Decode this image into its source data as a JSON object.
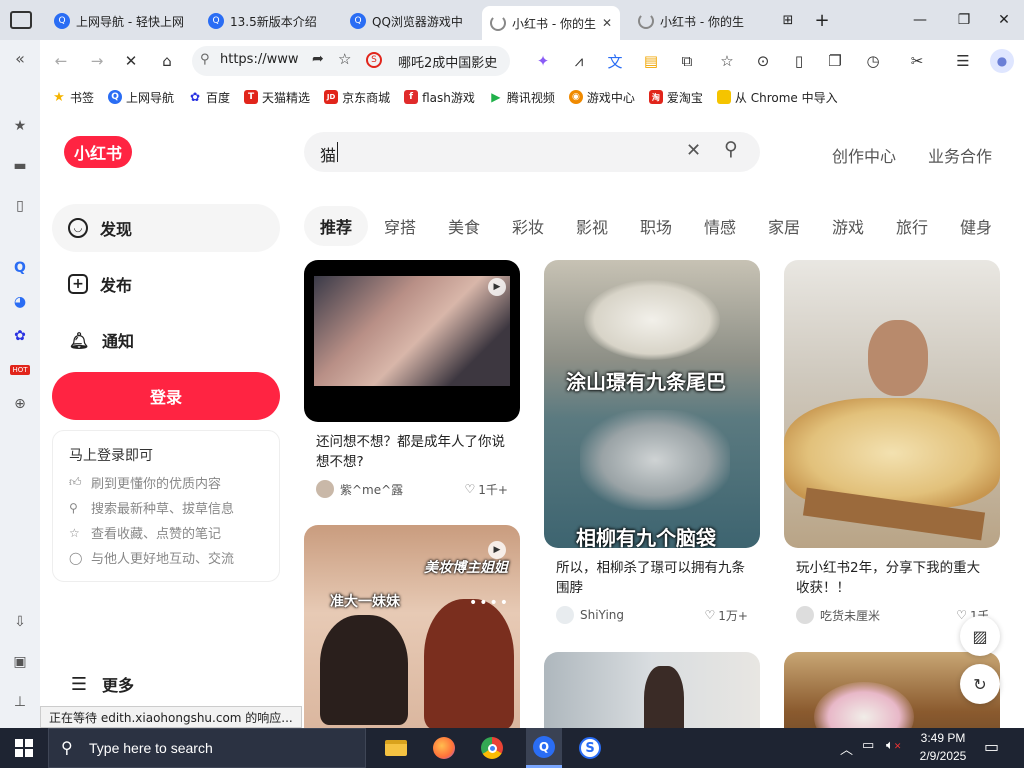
{
  "tabs": [
    {
      "label": "上网导航 - 轻快上网",
      "icon": "qq-browser-icon",
      "active": false
    },
    {
      "label": "13.5新版本介绍",
      "icon": "qq-browser-icon",
      "active": false
    },
    {
      "label": "QQ浏览器游戏中",
      "icon": "qq-browser-icon",
      "active": false
    },
    {
      "label": "小红书 - 你的生",
      "icon": "loading-spinner-icon",
      "active": true
    },
    {
      "label": "小红书 - 你的生",
      "icon": "loading-spinner-icon",
      "active": false
    }
  ],
  "toolbar": {
    "url": "https://www",
    "search_hint": "哪吒2成中国影史"
  },
  "bookmarks": [
    {
      "label": "书签",
      "color": "#f5b400",
      "glyph": "★"
    },
    {
      "label": "上网导航",
      "color": "#2a6df4",
      "glyph": "Q"
    },
    {
      "label": "百度",
      "color": "#2932e1",
      "glyph": "✿"
    },
    {
      "label": "天猫精选",
      "color": "#e1251b",
      "glyph": "T"
    },
    {
      "label": "京东商城",
      "color": "#e1251b",
      "glyph": "JD"
    },
    {
      "label": "flash游戏",
      "color": "#e02b2b",
      "glyph": "f"
    },
    {
      "label": "腾讯视频",
      "color": "#20b14a",
      "glyph": "▶"
    },
    {
      "label": "游戏中心",
      "color": "#f08a00",
      "glyph": "◉"
    },
    {
      "label": "爱淘宝",
      "color": "#e1251b",
      "glyph": "淘"
    },
    {
      "label": "从 Chrome 中导入",
      "color": "#f5c400",
      "glyph": ""
    }
  ],
  "site": {
    "logo": "小红书",
    "search_value": "猫",
    "header_links": [
      "创作中心",
      "业务合作"
    ],
    "nav": [
      {
        "label": "发现",
        "icon": "discover-icon"
      },
      {
        "label": "发布",
        "icon": "publish-plus-icon"
      },
      {
        "label": "通知",
        "icon": "bell-icon"
      }
    ],
    "login_button": "登录",
    "login_box": {
      "title": "马上登录即可",
      "perks": [
        "刷到更懂你的优质内容",
        "搜索最新种草、拔草信息",
        "查看收藏、点赞的笔记",
        "与他人更好地互动、交流"
      ]
    },
    "more": "更多",
    "channels": [
      "推荐",
      "穿搭",
      "美食",
      "彩妆",
      "影视",
      "职场",
      "情感",
      "家居",
      "游戏",
      "旅行",
      "健身"
    ],
    "cards": [
      {
        "title": "还问想不想？都是成年人了你说想不想?",
        "author": "紫^me^露",
        "likes": "1千+"
      },
      {
        "title": "所以，相柳杀了璟可以拥有九条围脖",
        "author": "ShiYing",
        "likes": "1万+",
        "overlay_top": "涂山璟有九条尾巴",
        "overlay_bottom": "相柳有九个脑袋"
      },
      {
        "title": "玩小红书2年，分享下我的重大收获！！",
        "author": "吃货未厘米",
        "likes": "1千+"
      },
      {
        "overlay_a": "美妆博主姐姐",
        "overlay_b": "准大一妹妹"
      }
    ]
  },
  "status_text": "正在等待 edith.xiaohongshu.com 的响应...",
  "taskbar": {
    "search_placeholder": "Type here to search",
    "time": "3:49 PM",
    "date": "2/9/2025"
  }
}
